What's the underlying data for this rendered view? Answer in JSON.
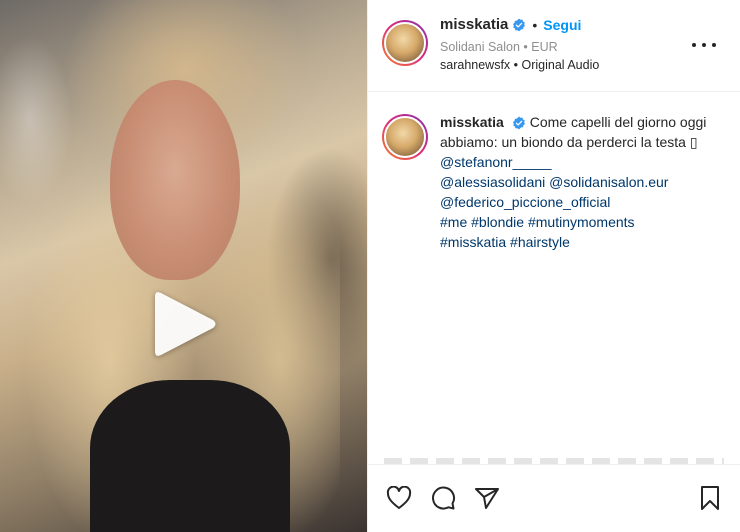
{
  "post": {
    "username": "misskatia",
    "follow_label": "Segui",
    "separator": "•",
    "location": "Solidani Salon • EUR",
    "audio": "sarahnewsfx • Original Audio"
  },
  "caption": {
    "username": "misskatia",
    "text_1": "Come capelli del giorno oggi abbiamo: un biondo da perderci la testa ▯ ",
    "mention_1": "@stefanonr_____",
    "mention_2": "@alessiasolidani",
    "mention_3": "@solidanisalon.eur",
    "mention_4": "@federico_piccione_official",
    "hashtag_1": "#me",
    "hashtag_2": "#blondie",
    "hashtag_3": "#mutinymoments",
    "hashtag_4": "#misskatia",
    "hashtag_5": "#hairstyle"
  },
  "icons": {
    "play": "play-icon",
    "verified": "verified-badge-icon",
    "more": "more-options-icon",
    "like": "heart-icon",
    "comment": "comment-icon",
    "share": "send-icon",
    "save": "bookmark-icon"
  },
  "colors": {
    "accent": "#0095f6",
    "verified": "#3897f0",
    "link": "#00376b",
    "text": "#262626",
    "muted": "#8e8e8e"
  }
}
